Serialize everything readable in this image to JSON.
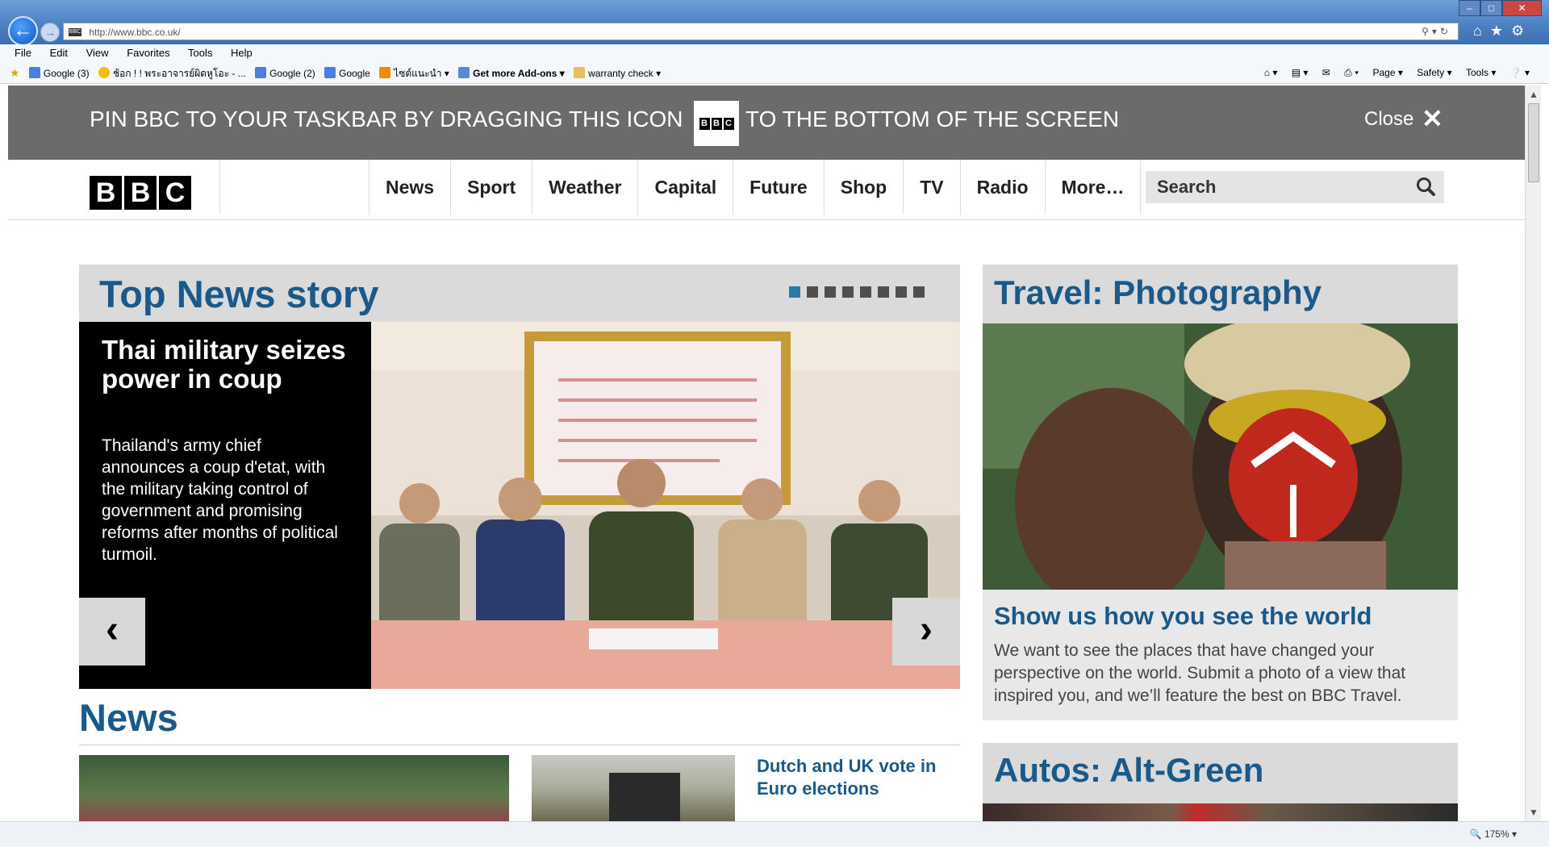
{
  "browser": {
    "address": "http://www.bbc.co.uk/",
    "menu": [
      "File",
      "Edit",
      "View",
      "Favorites",
      "Tools",
      "Help"
    ],
    "favorites": [
      "Google (3)",
      "ช้อก ! ! พระอาจารย์ผิดหูโอะ - ...",
      "Google (2)",
      "Google",
      "ไซต์แนะนำ ▾",
      "Get more Add-ons ▾",
      "warranty check ▾"
    ],
    "commands": [
      "Page ▾",
      "Safety ▾",
      "Tools ▾"
    ],
    "zoom": "175%"
  },
  "pin_banner": {
    "text_before": "PIN BBC TO YOUR TASKBAR BY DRAGGING THIS ICON",
    "text_after": "TO THE BOTTOM OF THE SCREEN",
    "close": "Close"
  },
  "bbc": {
    "logo": [
      "B",
      "B",
      "C"
    ],
    "nav": [
      "News",
      "Sport",
      "Weather",
      "Capital",
      "Future",
      "Shop",
      "TV",
      "Radio",
      "More…"
    ],
    "search_placeholder": "Search"
  },
  "top_news": {
    "title": "Top News story",
    "dots": 8,
    "active_dot": 1,
    "headline": "Thai military seizes power in coup",
    "summary": "Thailand's army chief announces a coup d'etat, with the military taking control of government and promising reforms after months of political turmoil."
  },
  "news": {
    "heading": "News",
    "story2": "Dutch and UK vote in Euro elections"
  },
  "travel": {
    "title": "Travel: Photography",
    "headline": "Show us how you see the world",
    "body": "We want to see the places that have changed your perspective on the world. Submit a photo of a view that inspired you, and we’ll feature the best on BBC Travel."
  },
  "autos": {
    "title": "Autos: Alt-Green"
  }
}
